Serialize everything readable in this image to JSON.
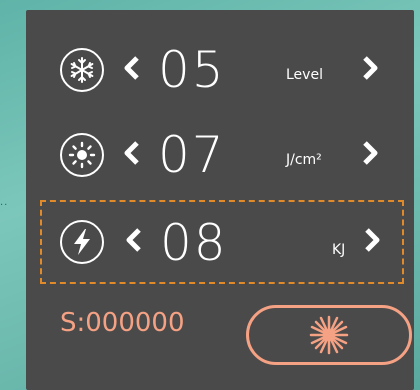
{
  "rows": [
    {
      "value": "05",
      "unit": "Level",
      "icon": "snowflake-icon"
    },
    {
      "value": "07",
      "unit": "J/cm²",
      "icon": "sun-icon"
    },
    {
      "value": "08",
      "unit": "KJ",
      "icon": "lightning-icon"
    }
  ],
  "counter": {
    "text": "S:000000"
  },
  "colors": {
    "accent": "#f5a184",
    "selected_border": "#e08a2a",
    "panel": "#4a4a4a"
  }
}
